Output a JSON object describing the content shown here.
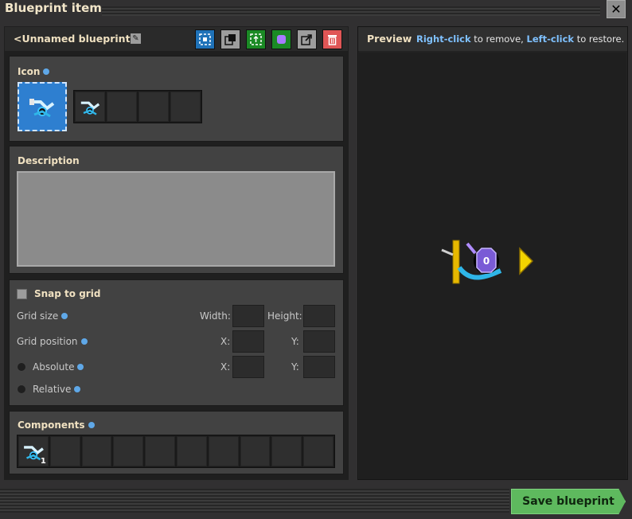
{
  "window": {
    "title": "Blueprint item",
    "close_label": "✕"
  },
  "blueprint": {
    "name": "<Unnamed blueprint>"
  },
  "icon_section": {
    "label": "Icon"
  },
  "description_section": {
    "label": "Description",
    "value": ""
  },
  "grid_section": {
    "snap_label": "Snap to grid",
    "grid_size_label": "Grid size",
    "width_label": "Width:",
    "height_label": "Height:",
    "grid_position_label": "Grid position",
    "x_label": "X:",
    "y_label": "Y:",
    "absolute_label": "Absolute",
    "relative_label": "Relative"
  },
  "components": {
    "label": "Components",
    "items": [
      {
        "icon": "smart-inserter-icon",
        "count": "1"
      }
    ]
  },
  "preview": {
    "title": "Preview",
    "hint_parts": [
      "Right-click",
      " to remove, ",
      "Left-click",
      " to restore."
    ],
    "combinator_value": "0"
  },
  "footer": {
    "save_label": "Save blueprint"
  },
  "colors": {
    "accent_blue": "#1f72b8",
    "accent_green": "#1b8a25",
    "danger": "#e05656",
    "save": "#5eb95e"
  }
}
